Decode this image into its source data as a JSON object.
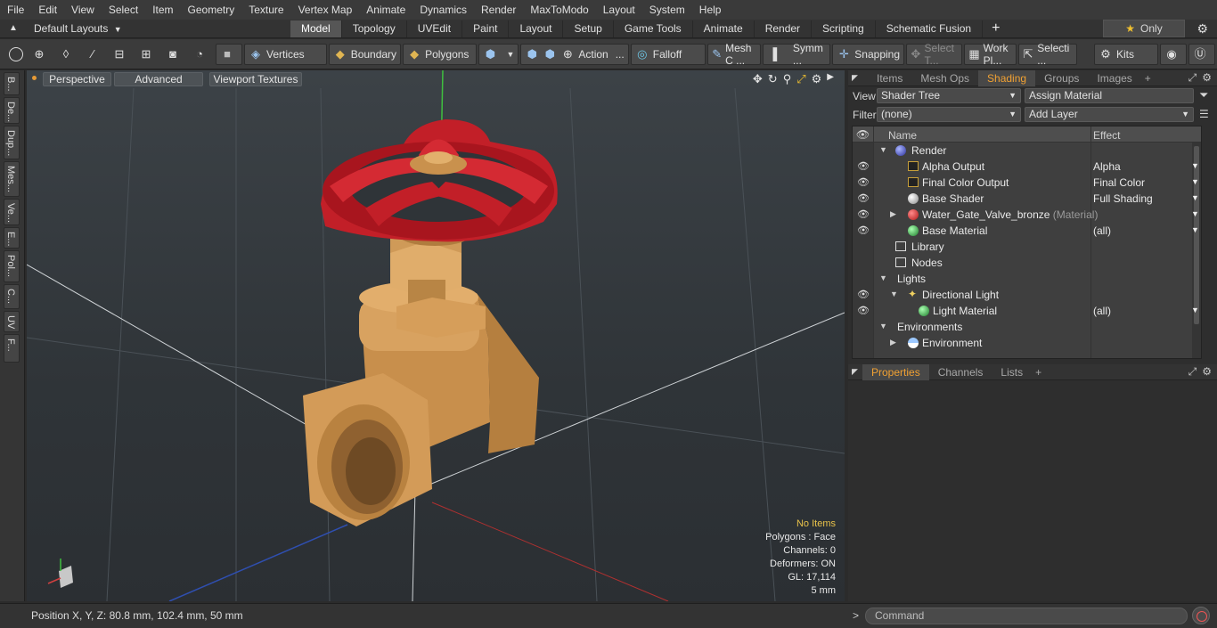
{
  "menu": [
    "File",
    "Edit",
    "View",
    "Select",
    "Item",
    "Geometry",
    "Texture",
    "Vertex Map",
    "Animate",
    "Dynamics",
    "Render",
    "MaxToModo",
    "Layout",
    "System",
    "Help"
  ],
  "layout_bar": {
    "layout_select": "Default Layouts",
    "tabs": [
      "Model",
      "Topology",
      "UVEdit",
      "Paint",
      "Layout",
      "Setup",
      "Game Tools",
      "Animate",
      "Render",
      "Scripting",
      "Schematic Fusion"
    ],
    "active_tab": "Model",
    "add": "+",
    "only_label": "Only"
  },
  "toolbar": {
    "vertices": "Vertices",
    "boundary": "Boundary",
    "polygons": "Polygons",
    "action": "Action",
    "falloff": "Falloff",
    "mesh": "Mesh C ...",
    "symm": "Symm ...",
    "snapping": "Snapping",
    "select_t": "Select T...",
    "work_pl": "Work Pl...",
    "selecti": "Selecti ...",
    "kits": "Kits",
    "ellipsis": "..."
  },
  "left_strip": [
    "B...",
    "De...",
    "Dup...",
    "Mes...",
    "Ve...",
    "E...",
    "Pol...",
    "C...",
    "UV",
    "F..."
  ],
  "viewport": {
    "perspective": "Perspective",
    "advanced": "Advanced",
    "viewport_textures": "Viewport Textures",
    "info": {
      "no_items": "No Items",
      "polygons": "Polygons : Face",
      "channels": "Channels: 0",
      "deformers": "Deformers: ON",
      "gl": "GL: 17,114",
      "scale": "5 mm"
    }
  },
  "right_panel": {
    "tabs": [
      "Items",
      "Mesh Ops",
      "Shading",
      "Groups",
      "Images"
    ],
    "active_tab": "Shading",
    "add": "+",
    "view_label": "View",
    "view_value": "Shader Tree",
    "assign_material": "Assign Material",
    "filter_label": "Filter",
    "filter_value": "(none)",
    "add_layer": "Add Layer",
    "tree_header": {
      "name": "Name",
      "effect": "Effect"
    },
    "tree": [
      {
        "name": "Render",
        "effect": "",
        "eye": false,
        "level": 0,
        "expand": "down",
        "icon": "sphere-blue"
      },
      {
        "name": "Alpha Output",
        "effect": "Alpha",
        "eye": true,
        "level": 2,
        "expand": "",
        "icon": "output"
      },
      {
        "name": "Final Color Output",
        "effect": "Final Color",
        "eye": true,
        "level": 2,
        "expand": "",
        "icon": "output"
      },
      {
        "name": "Base Shader",
        "effect": "Full Shading",
        "eye": true,
        "level": 2,
        "expand": "",
        "icon": "sphere-white"
      },
      {
        "name": "Water_Gate_Valve_bronze",
        "sub": "(Material)",
        "effect": "",
        "eye": true,
        "level": 1,
        "expand": "right",
        "icon": "sphere-red"
      },
      {
        "name": "Base Material",
        "effect": "(all)",
        "eye": true,
        "level": 2,
        "expand": "",
        "icon": "sphere-green"
      },
      {
        "name": "Library",
        "effect": "",
        "eye": false,
        "level": 1,
        "expand": "",
        "icon": "folder"
      },
      {
        "name": "Nodes",
        "effect": "",
        "eye": false,
        "level": 1,
        "expand": "",
        "icon": "folder"
      },
      {
        "name": "Lights",
        "effect": "",
        "eye": false,
        "level": 0,
        "expand": "down",
        "icon": ""
      },
      {
        "name": "Directional Light",
        "effect": "",
        "eye": true,
        "level": 1,
        "expand": "down",
        "icon": "light"
      },
      {
        "name": "Light Material",
        "effect": "(all)",
        "eye": true,
        "level": 3,
        "expand": "",
        "icon": "sphere-green"
      },
      {
        "name": "Environments",
        "effect": "",
        "eye": false,
        "level": 0,
        "expand": "down",
        "icon": ""
      },
      {
        "name": "Environment",
        "effect": "",
        "eye": false,
        "level": 1,
        "expand": "right",
        "icon": "sphere-env"
      }
    ],
    "props_tabs": [
      "Properties",
      "Channels",
      "Lists"
    ],
    "props_active": "Properties"
  },
  "status": {
    "position": "Position X, Y, Z:  80.8 mm, 102.4 mm, 50 mm",
    "command_prompt": ">",
    "command_placeholder": "Command"
  },
  "colors": {
    "accent": "#f0a133",
    "info_highlight": "#e8c24a",
    "valve_handle": "#c8202a",
    "valve_body": "#d9a25a"
  }
}
